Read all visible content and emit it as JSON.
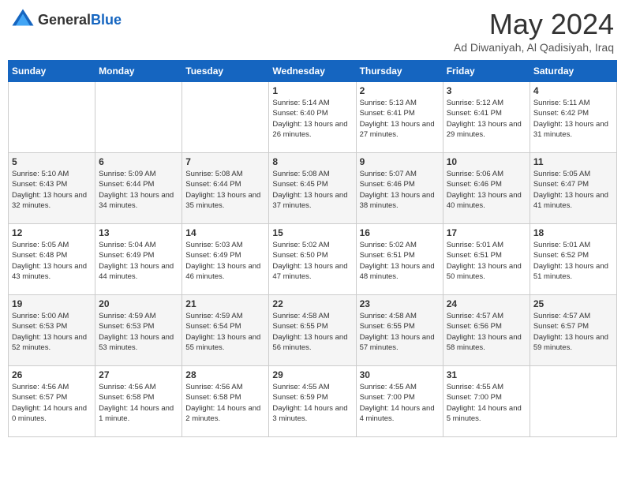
{
  "header": {
    "logo": {
      "general": "General",
      "blue": "Blue"
    },
    "title": "May 2024",
    "location": "Ad Diwaniyah, Al Qadisiyah, Iraq"
  },
  "calendar": {
    "days_of_week": [
      "Sunday",
      "Monday",
      "Tuesday",
      "Wednesday",
      "Thursday",
      "Friday",
      "Saturday"
    ],
    "weeks": [
      [
        {
          "day": "",
          "info": ""
        },
        {
          "day": "",
          "info": ""
        },
        {
          "day": "",
          "info": ""
        },
        {
          "day": "1",
          "info": "Sunrise: 5:14 AM\nSunset: 6:40 PM\nDaylight: 13 hours and 26 minutes."
        },
        {
          "day": "2",
          "info": "Sunrise: 5:13 AM\nSunset: 6:41 PM\nDaylight: 13 hours and 27 minutes."
        },
        {
          "day": "3",
          "info": "Sunrise: 5:12 AM\nSunset: 6:41 PM\nDaylight: 13 hours and 29 minutes."
        },
        {
          "day": "4",
          "info": "Sunrise: 5:11 AM\nSunset: 6:42 PM\nDaylight: 13 hours and 31 minutes."
        }
      ],
      [
        {
          "day": "5",
          "info": "Sunrise: 5:10 AM\nSunset: 6:43 PM\nDaylight: 13 hours and 32 minutes."
        },
        {
          "day": "6",
          "info": "Sunrise: 5:09 AM\nSunset: 6:44 PM\nDaylight: 13 hours and 34 minutes."
        },
        {
          "day": "7",
          "info": "Sunrise: 5:08 AM\nSunset: 6:44 PM\nDaylight: 13 hours and 35 minutes."
        },
        {
          "day": "8",
          "info": "Sunrise: 5:08 AM\nSunset: 6:45 PM\nDaylight: 13 hours and 37 minutes."
        },
        {
          "day": "9",
          "info": "Sunrise: 5:07 AM\nSunset: 6:46 PM\nDaylight: 13 hours and 38 minutes."
        },
        {
          "day": "10",
          "info": "Sunrise: 5:06 AM\nSunset: 6:46 PM\nDaylight: 13 hours and 40 minutes."
        },
        {
          "day": "11",
          "info": "Sunrise: 5:05 AM\nSunset: 6:47 PM\nDaylight: 13 hours and 41 minutes."
        }
      ],
      [
        {
          "day": "12",
          "info": "Sunrise: 5:05 AM\nSunset: 6:48 PM\nDaylight: 13 hours and 43 minutes."
        },
        {
          "day": "13",
          "info": "Sunrise: 5:04 AM\nSunset: 6:49 PM\nDaylight: 13 hours and 44 minutes."
        },
        {
          "day": "14",
          "info": "Sunrise: 5:03 AM\nSunset: 6:49 PM\nDaylight: 13 hours and 46 minutes."
        },
        {
          "day": "15",
          "info": "Sunrise: 5:02 AM\nSunset: 6:50 PM\nDaylight: 13 hours and 47 minutes."
        },
        {
          "day": "16",
          "info": "Sunrise: 5:02 AM\nSunset: 6:51 PM\nDaylight: 13 hours and 48 minutes."
        },
        {
          "day": "17",
          "info": "Sunrise: 5:01 AM\nSunset: 6:51 PM\nDaylight: 13 hours and 50 minutes."
        },
        {
          "day": "18",
          "info": "Sunrise: 5:01 AM\nSunset: 6:52 PM\nDaylight: 13 hours and 51 minutes."
        }
      ],
      [
        {
          "day": "19",
          "info": "Sunrise: 5:00 AM\nSunset: 6:53 PM\nDaylight: 13 hours and 52 minutes."
        },
        {
          "day": "20",
          "info": "Sunrise: 4:59 AM\nSunset: 6:53 PM\nDaylight: 13 hours and 53 minutes."
        },
        {
          "day": "21",
          "info": "Sunrise: 4:59 AM\nSunset: 6:54 PM\nDaylight: 13 hours and 55 minutes."
        },
        {
          "day": "22",
          "info": "Sunrise: 4:58 AM\nSunset: 6:55 PM\nDaylight: 13 hours and 56 minutes."
        },
        {
          "day": "23",
          "info": "Sunrise: 4:58 AM\nSunset: 6:55 PM\nDaylight: 13 hours and 57 minutes."
        },
        {
          "day": "24",
          "info": "Sunrise: 4:57 AM\nSunset: 6:56 PM\nDaylight: 13 hours and 58 minutes."
        },
        {
          "day": "25",
          "info": "Sunrise: 4:57 AM\nSunset: 6:57 PM\nDaylight: 13 hours and 59 minutes."
        }
      ],
      [
        {
          "day": "26",
          "info": "Sunrise: 4:56 AM\nSunset: 6:57 PM\nDaylight: 14 hours and 0 minutes."
        },
        {
          "day": "27",
          "info": "Sunrise: 4:56 AM\nSunset: 6:58 PM\nDaylight: 14 hours and 1 minute."
        },
        {
          "day": "28",
          "info": "Sunrise: 4:56 AM\nSunset: 6:58 PM\nDaylight: 14 hours and 2 minutes."
        },
        {
          "day": "29",
          "info": "Sunrise: 4:55 AM\nSunset: 6:59 PM\nDaylight: 14 hours and 3 minutes."
        },
        {
          "day": "30",
          "info": "Sunrise: 4:55 AM\nSunset: 7:00 PM\nDaylight: 14 hours and 4 minutes."
        },
        {
          "day": "31",
          "info": "Sunrise: 4:55 AM\nSunset: 7:00 PM\nDaylight: 14 hours and 5 minutes."
        },
        {
          "day": "",
          "info": ""
        }
      ]
    ]
  }
}
